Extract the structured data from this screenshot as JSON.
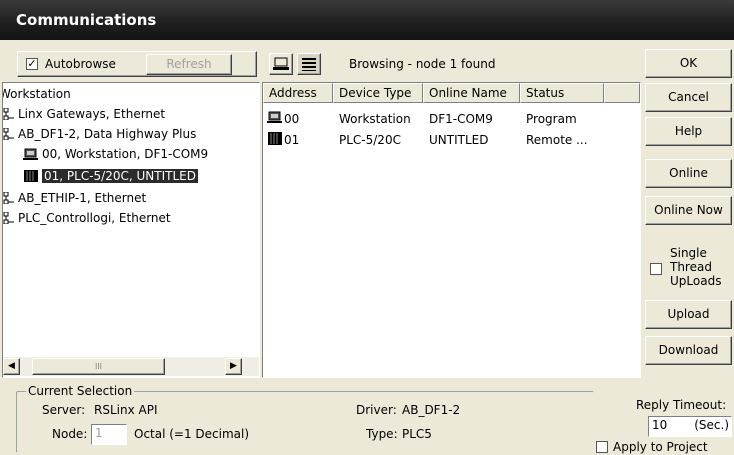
{
  "window": {
    "title": "Communications"
  },
  "toolbar": {
    "autobrowse_label": "Autobrowse",
    "autobrowse_checked": true,
    "refresh_label": "Refresh",
    "status_text": "Browsing - node 1 found"
  },
  "tree": {
    "root": "Workstation",
    "items": [
      "Linx Gateways, Ethernet",
      "AB_DF1-2, Data Highway Plus",
      "00, Workstation, DF1-COM9",
      "01, PLC-5/20C, UNTITLED",
      "AB_ETHIP-1, Ethernet",
      "PLC_Controllogi, Ethernet"
    ],
    "scroll_thumb_text": "III"
  },
  "table": {
    "headers": [
      "Address",
      "Device Type",
      "Online Name",
      "Status"
    ],
    "rows": [
      [
        "00",
        "Workstation",
        "DF1-COM9",
        "Program"
      ],
      [
        "01",
        "PLC-5/20C",
        "UNTITLED",
        "Remote ..."
      ]
    ]
  },
  "buttons": {
    "ok": "OK",
    "cancel": "Cancel",
    "help": "Help",
    "online": "Online",
    "online_now": "Online Now",
    "single_thread_1": "Single",
    "single_thread_2": "Thread",
    "single_thread_3": "UpLoads",
    "upload": "Upload",
    "download": "Download"
  },
  "selection": {
    "group_label": "Current Selection",
    "server_label": "Server:",
    "server_value": "RSLinx API",
    "node_label": "Node:",
    "node_value": "1",
    "octal_text": "Octal (=1 Decimal)",
    "driver_label": "Driver:",
    "driver_value": "AB_DF1-2",
    "type_label": "Type:",
    "type_value": "PLC5"
  },
  "timeout": {
    "label": "Reply Timeout:",
    "value": "10",
    "unit": "(Sec.)",
    "apply_label": "Apply to Project"
  }
}
